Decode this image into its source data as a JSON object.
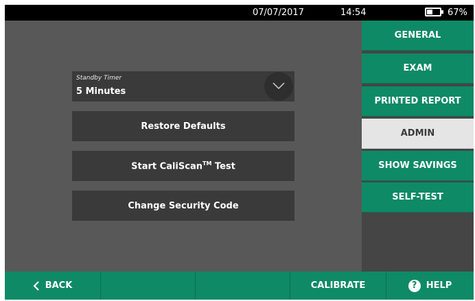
{
  "status": {
    "date": "07/07/2017",
    "time": "14:54",
    "battery": "67%",
    "battery_icon": "battery-icon"
  },
  "main": {
    "standby": {
      "label": "Standby Timer",
      "value": "5 Minutes",
      "icon": "chevron-down-icon"
    },
    "restore_label": "Restore Defaults",
    "caliscan_prefix": "Start CaliScan",
    "caliscan_tm": "TM",
    "caliscan_suffix": " Test",
    "security_label": "Change Security Code"
  },
  "side_menu": {
    "items": [
      {
        "label": "GENERAL"
      },
      {
        "label": "EXAM"
      },
      {
        "label": "PRINTED REPORT"
      },
      {
        "label": "ADMIN",
        "active": true
      },
      {
        "label": "SHOW SAVINGS"
      },
      {
        "label": "SELF-TEST"
      }
    ]
  },
  "bottom": {
    "back_label": "BACK",
    "back_icon": "chevron-left-icon",
    "calibrate_label": "CALIBRATE",
    "help_label": "HELP",
    "help_icon": "help-icon",
    "help_glyph": "?"
  },
  "colors": {
    "accent": "#0e8a66",
    "background": "#585858",
    "button": "#3a3a3a",
    "active_tab": "#e5e5e5"
  }
}
